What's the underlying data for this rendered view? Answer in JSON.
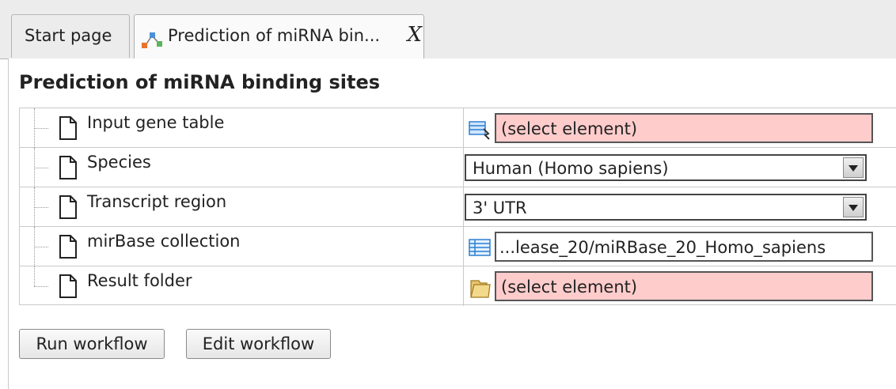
{
  "tabs": [
    {
      "label": "Start page",
      "active": false
    },
    {
      "label": "Prediction of miRNA bin...",
      "active": true,
      "close": "X"
    }
  ],
  "page": {
    "title": "Prediction of miRNA binding sites"
  },
  "parameters": [
    {
      "label": "Input gene table",
      "control": "select-element",
      "icon": "table-link-icon",
      "value": "(select element)"
    },
    {
      "label": "Species",
      "control": "dropdown",
      "value": "Human (Homo sapiens)"
    },
    {
      "label": "Transcript region",
      "control": "dropdown",
      "value": "3' UTR"
    },
    {
      "label": "mirBase collection",
      "control": "text",
      "icon": "table-icon",
      "value": "...lease_20/miRBase_20_Homo_sapiens"
    },
    {
      "label": "Result folder",
      "control": "select-element",
      "icon": "folder-icon",
      "value": "(select element)"
    }
  ],
  "buttons": {
    "run": "Run workflow",
    "edit": "Edit workflow"
  },
  "colors": {
    "required_field_bg": "#ffcccc",
    "tab_bg": "#ececec",
    "active_tab_bg": "#fafafa"
  }
}
